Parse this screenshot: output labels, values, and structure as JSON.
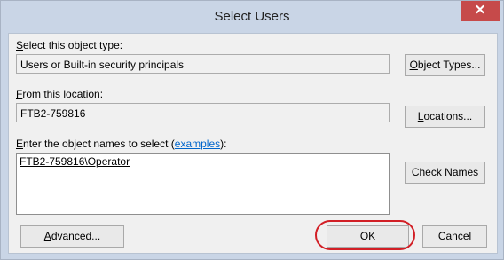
{
  "window": {
    "title": "Select Users",
    "close_glyph": "✕"
  },
  "object_type": {
    "label_accel": "S",
    "label_rest": "elect this object type:",
    "value": "Users or Built-in security principals",
    "button_accel": "O",
    "button_rest": "bject Types..."
  },
  "location": {
    "label_accel": "F",
    "label_rest": "rom this location:",
    "value": "FTB2-759816",
    "button_accel": "L",
    "button_rest": "ocations..."
  },
  "names": {
    "label_accel": "E",
    "label_rest": "nter the object names to select (",
    "examples_link": "examples",
    "label_end": "):",
    "value": "FTB2-759816\\Operator",
    "check_accel": "C",
    "check_rest": "heck Names"
  },
  "buttons": {
    "advanced_accel": "A",
    "advanced_rest": "dvanced...",
    "ok": "OK",
    "cancel": "Cancel"
  },
  "colors": {
    "highlight": "#d21f26",
    "link": "#0066cc",
    "close": "#c64a4a"
  }
}
